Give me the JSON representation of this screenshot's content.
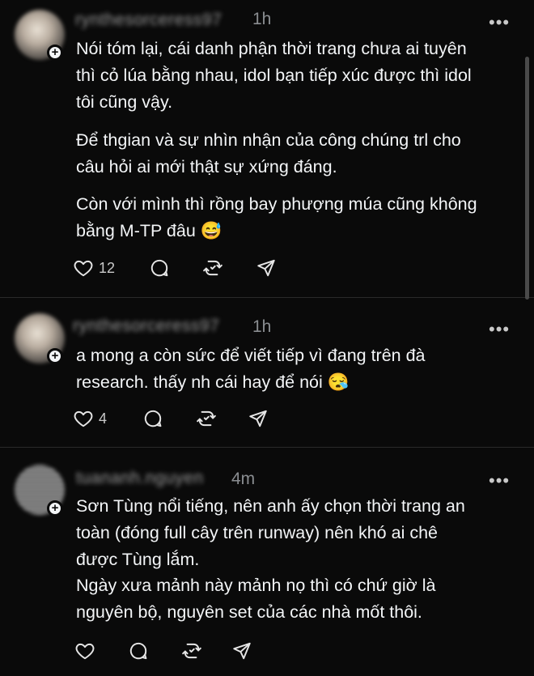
{
  "posts": [
    {
      "username": "rynthesorceress97",
      "time": "1h",
      "paragraphs": [
        [
          "Nói tóm lại, cái danh phận thời trang chưa ai tuyên",
          "thì cỏ lúa bằng nhau, idol bạn tiếp xúc được thì idol",
          "tôi cũng vậy."
        ],
        [
          "Để thgian và sự nhìn nhận của công chúng trl cho",
          "câu hỏi ai mới thật sự xứng đáng."
        ],
        [
          "Còn với mình thì rồng bay phượng múa cũng không",
          "bằng M-TP đâu 😅"
        ]
      ],
      "likes": "12",
      "more_icon": "more-horizontal-icon"
    },
    {
      "username": "rynthesorceress97",
      "time": "1h",
      "paragraphs": [
        [
          "a mong a còn sức để viết tiếp vì đang trên đà",
          "research. thấy nh cái hay để nói 😪"
        ]
      ],
      "likes": "4",
      "more_icon": "more-horizontal-icon"
    },
    {
      "username": "tuananh.nguyen",
      "time": "4m",
      "paragraphs": [
        [
          "Sơn Tùng nổi tiếng, nên anh ấy chọn thời trang an",
          "toàn (đóng full cây trên runway) nên khó ai chê",
          "được Tùng lắm."
        ],
        [
          "Ngày xưa mảnh này mảnh nọ thì có chứ giờ là",
          "nguyên bộ, nguyên set của các nhà mốt thôi."
        ]
      ],
      "likes": "",
      "more_icon": "more-horizontal-icon"
    }
  ],
  "more_glyph": "•••",
  "plus_glyph": "+",
  "icons": [
    "heart-icon",
    "comment-icon",
    "repost-icon",
    "share-icon"
  ],
  "colors": {
    "background": "#0a0a0a",
    "text": "#f3f5f7",
    "muted": "#8a8d91"
  }
}
